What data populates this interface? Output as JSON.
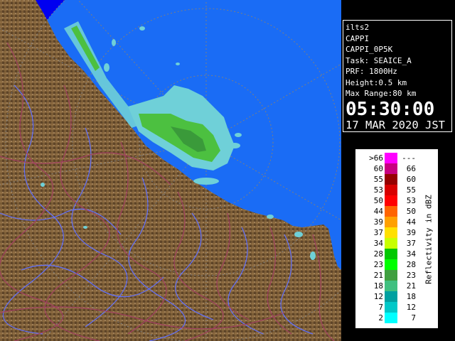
{
  "radar_info": {
    "site": "ilts2",
    "product": "CAPPI",
    "product_id": "CAPPI_0P5K",
    "task": "Task: SEAICE_A",
    "prf": "PRF: 1800Hz",
    "height": "Height:0.5 km",
    "max_range": "Max Range:80 km",
    "time": "05:30:00",
    "date": "17 MAR 2020 JST"
  },
  "legend": {
    "title": "Reflectivity in dBZ",
    "rows": [
      {
        "lo": ">66",
        "hi": "---",
        "color": "#ff00ff"
      },
      {
        "lo": "60",
        "hi": "66",
        "color": "#c80080"
      },
      {
        "lo": "55",
        "hi": "60",
        "color": "#960000"
      },
      {
        "lo": "53",
        "hi": "55",
        "color": "#d80000"
      },
      {
        "lo": "50",
        "hi": "53",
        "color": "#ff0000"
      },
      {
        "lo": "44",
        "hi": "50",
        "color": "#ff6400"
      },
      {
        "lo": "39",
        "hi": "44",
        "color": "#ffa000"
      },
      {
        "lo": "37",
        "hi": "39",
        "color": "#ffe000"
      },
      {
        "lo": "34",
        "hi": "37",
        "color": "#c8ff00"
      },
      {
        "lo": "28",
        "hi": "34",
        "color": "#00c800"
      },
      {
        "lo": "23",
        "hi": "28",
        "color": "#00ff00"
      },
      {
        "lo": "21",
        "hi": "23",
        "color": "#40a040"
      },
      {
        "lo": "18",
        "hi": "21",
        "color": "#40c080"
      },
      {
        "lo": "12",
        "hi": "18",
        "color": "#00a0a0"
      },
      {
        "lo": "7",
        "hi": "12",
        "color": "#00c8c8"
      },
      {
        "lo": "2",
        "hi": "7",
        "color": "#00ffff"
      }
    ]
  },
  "colors": {
    "sea_outside_range": "#0000f0",
    "sea_inside_range": "#1a6cf5",
    "terrain": "#7a5c36",
    "roads": "#a04060",
    "rivers": "#6070ff",
    "echo_light": "#6fd0d8",
    "echo_green": "#4cc040"
  }
}
